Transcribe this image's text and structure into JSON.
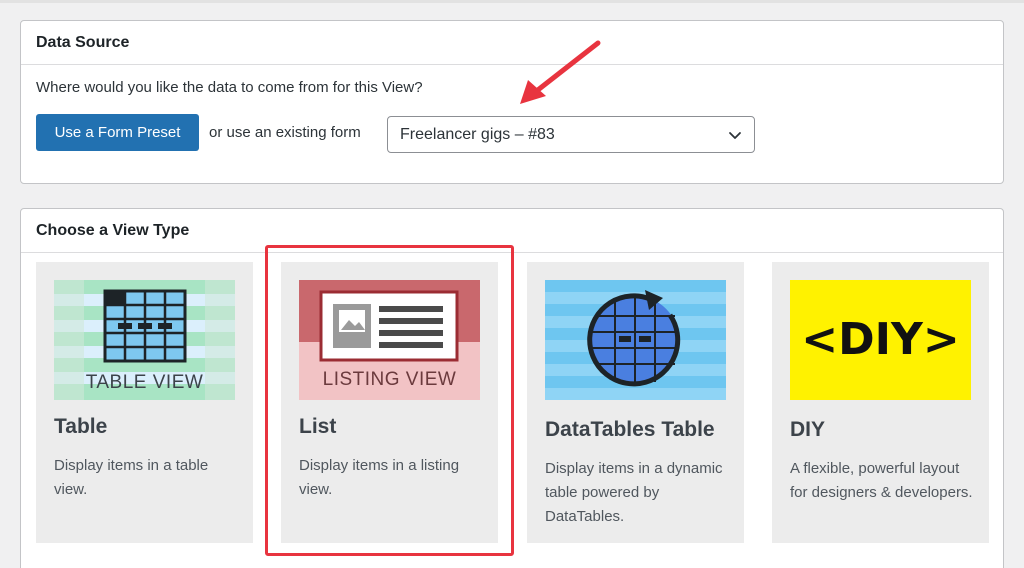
{
  "data_source": {
    "heading": "Data Source",
    "question": "Where would you like the data to come from for this View?",
    "preset_button": "Use a Form Preset",
    "or_text": "or use an existing form",
    "selected_form": "Freelancer gigs – #83"
  },
  "view_type": {
    "heading": "Choose a View Type",
    "cards": [
      {
        "title": "Table",
        "description": "Display items in a table view.",
        "thumb_label": "TABLE VIEW"
      },
      {
        "title": "List",
        "description": "Display items in a listing view.",
        "thumb_label": "LISTING VIEW"
      },
      {
        "title": "DataTables Table",
        "description": "Display items in a dynamic table powered by DataTables."
      },
      {
        "title": "DIY",
        "description": "A flexible, powerful layout for designers & developers.",
        "thumb_label": "<DIY>"
      }
    ]
  },
  "colors": {
    "button_blue": "#2271b1",
    "highlight_red": "#e8343f",
    "diy_yellow": "#fff200",
    "table_green": "#a8e4c4",
    "list_red": "#c9686d",
    "datatables_blue": "#6ec6f0"
  },
  "icons": {
    "select_chevron": "chevron-down-icon",
    "arrow": "red-pointer-arrow"
  }
}
